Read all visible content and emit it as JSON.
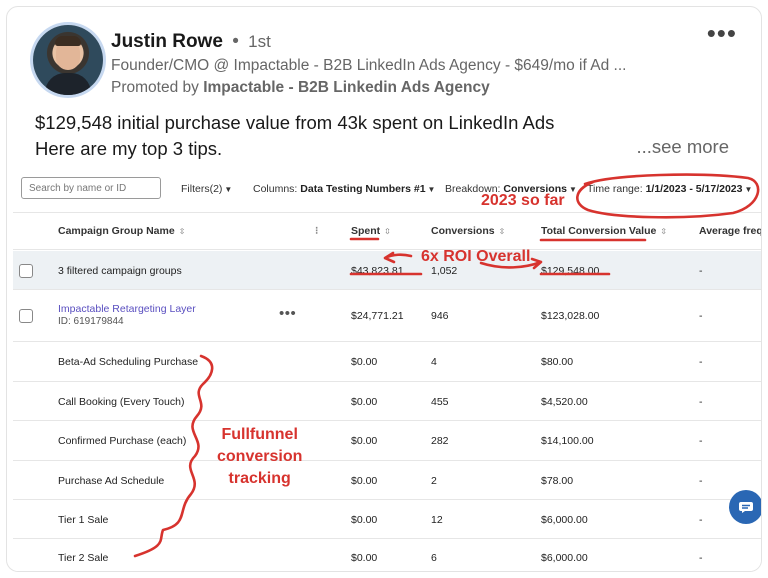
{
  "post": {
    "author_name": "Justin Rowe",
    "separator": "•",
    "degree": "1st",
    "headline": "Founder/CMO @ Impactable - B2B LinkedIn Ads Agency - $649/mo if Ad ...",
    "promoted_prefix": "Promoted by",
    "promoted_by": "Impactable - B2B Linkedin Ads Agency",
    "more_menu": "•••",
    "text_line1": "$129,548 initial purchase value from 43k spent on LinkedIn Ads",
    "text_line2": "Here are my top 3 tips.",
    "see_more": "...see more"
  },
  "toolbar": {
    "search_placeholder": "Search by name or ID",
    "filters_label": "Filters(2)",
    "columns_label": "Columns:",
    "columns_value": "Data Testing Numbers #1",
    "breakdown_label": "Breakdown:",
    "breakdown_value": "Conversions",
    "time_range_label": "Time range:",
    "time_range_value": "1/1/2023 - 5/17/2023"
  },
  "table": {
    "headers": {
      "name": "Campaign Group Name",
      "spent": "Spent",
      "conversions": "Conversions",
      "total_value": "Total Conversion Value",
      "avg_freq": "Average freque"
    },
    "summary": {
      "name": "3 filtered campaign groups",
      "spent": "$43,823.81",
      "conversions": "1,052",
      "value": "$129,548.00",
      "freq": "-"
    },
    "group": {
      "name": "Impactable Retargeting Layer",
      "id": "ID: 619179844",
      "menu": "•••",
      "spent": "$24,771.21",
      "conversions": "946",
      "value": "$123,028.00",
      "freq": "-"
    },
    "rows": [
      {
        "name": "Beta-Ad Scheduling Purchase",
        "spent": "$0.00",
        "conversions": "4",
        "value": "$80.00",
        "freq": "-"
      },
      {
        "name": "Call Booking (Every Touch)",
        "spent": "$0.00",
        "conversions": "455",
        "value": "$4,520.00",
        "freq": "-"
      },
      {
        "name": "Confirmed Purchase (each)",
        "spent": "$0.00",
        "conversions": "282",
        "value": "$14,100.00",
        "freq": "-"
      },
      {
        "name": "Purchase Ad Schedule",
        "spent": "$0.00",
        "conversions": "2",
        "value": "$78.00",
        "freq": "-"
      },
      {
        "name": "Tier 1 Sale",
        "spent": "$0.00",
        "conversions": "12",
        "value": "$6,000.00",
        "freq": "-"
      },
      {
        "name": "Tier 2 Sale",
        "spent": "$0.00",
        "conversions": "6",
        "value": "$6,000.00",
        "freq": "-"
      }
    ]
  },
  "annotations": {
    "so_far": "2023 so far",
    "roi": "6x ROI Overall",
    "funnel_1": "Fullfunnel",
    "funnel_2": "conversion",
    "funnel_3": "tracking",
    "color": "#d7332e"
  },
  "icons": {
    "chat_fab": "chat-bubble-icon",
    "sort": "sort-arrows-icon",
    "caret": "caret-down-icon"
  }
}
